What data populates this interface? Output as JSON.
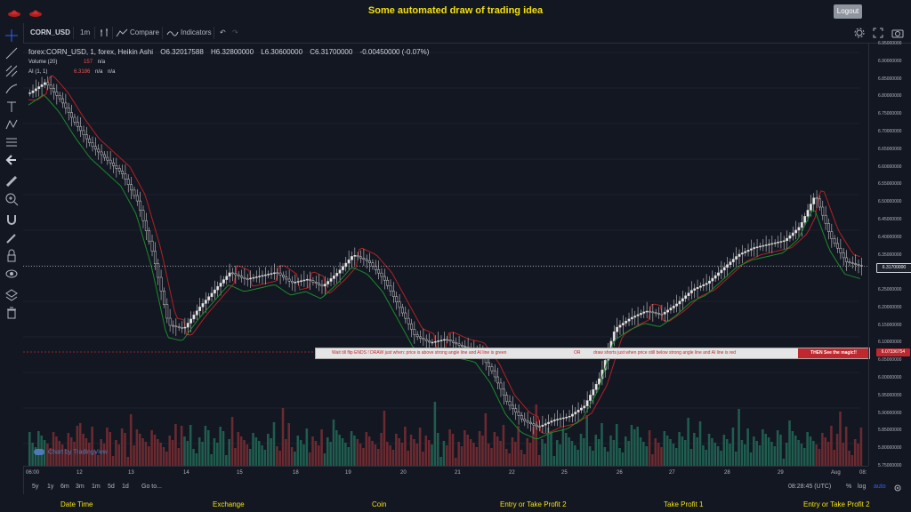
{
  "app": {
    "title": "Some automated draw of trading idea",
    "logout_label": "Logout"
  },
  "toolbar": {
    "symbol": "CORN_USD",
    "interval": "1m",
    "compare_label": "Compare",
    "indicators_label": "Indicators"
  },
  "legend": {
    "symbol_line": "forex:CORN_USD, 1, forex, Heikin Ashi",
    "open": "O6.32017588",
    "high": "H6.32800000",
    "low": "L6.30600000",
    "close": "C6.31700000",
    "change": "-0.00450000 (-0.07%)",
    "volume_label": "Volume (20)",
    "volume_value": "157",
    "volume_na": "n/a",
    "ai_label": "AI (1, 1)",
    "ai_value": "6.3186",
    "ai_na1": "n/a",
    "ai_na2": "n/a"
  },
  "price_axis": {
    "ticks": [
      "6.95000000",
      "6.90000000",
      "6.85000000",
      "6.80000000",
      "6.75000000",
      "6.70000000",
      "6.65000000",
      "6.60000000",
      "6.55000000",
      "6.50000000",
      "6.45000000",
      "6.40000000",
      "6.35000000",
      "6.30000000",
      "6.25000000",
      "6.20000000",
      "6.15000000",
      "6.10000000",
      "6.05000000",
      "6.00000000",
      "5.95000000",
      "5.90000000",
      "5.85000000",
      "5.80000000",
      "5.75000000"
    ],
    "current_price": "6.31700000",
    "marker_price": "6.07336754"
  },
  "time_axis": [
    "06:00",
    "12",
    "13",
    "14",
    "15",
    "18",
    "19",
    "20",
    "21",
    "22",
    "25",
    "26",
    "27",
    "28",
    "29",
    "Aug",
    "08:"
  ],
  "bottom_bar": {
    "ranges": [
      "5y",
      "1y",
      "6m",
      "3m",
      "1m",
      "5d",
      "1d"
    ],
    "goto": "Go to...",
    "clock": "08:28:45 (UTC)",
    "percent": "%",
    "log": "log",
    "auto": "auto"
  },
  "banner": {
    "part1": "Wait till flip ENDS  !   DRAW just when:  price is above strong angle line and AI line is green",
    "part2": "OR",
    "part3": "draw shorts just when price still below strong angle line and AI line is red",
    "part4": "THEN See the magic!!"
  },
  "watermark": "Chart by TradingView",
  "footer": [
    "Date Time",
    "Exchange",
    "Coin",
    "Entry or Take Profit 2",
    "Take Profit 1",
    "Entry or Take Profit 2"
  ],
  "colors": {
    "accent": "#f4e10a",
    "up": "#26a69a",
    "down": "#ef5350",
    "background": "#131722"
  },
  "chart_data": {
    "type": "line",
    "title": "",
    "series": [
      {
        "values": [
          6.81,
          6.84,
          6.79,
          6.72,
          6.66,
          6.62,
          6.58,
          6.5,
          6.35,
          6.15,
          6.14,
          6.2,
          6.25,
          6.3,
          6.28,
          6.29,
          6.3,
          6.27,
          6.28,
          6.26,
          6.3,
          6.35,
          6.33,
          6.28,
          6.2,
          6.12,
          6.1,
          6.11,
          6.09,
          6.08,
          6.02,
          5.93,
          5.88,
          5.86,
          5.88,
          5.89,
          5.92,
          6.0,
          6.14,
          6.17,
          6.19,
          6.18,
          6.21,
          6.25,
          6.27,
          6.31,
          6.35,
          6.37,
          6.38,
          6.39,
          6.43,
          6.52,
          6.4,
          6.33,
          6.317
        ]
      }
    ],
    "x": [
      "06:00",
      "12",
      "13",
      "14",
      "15",
      "18",
      "19",
      "20",
      "21",
      "22",
      "25",
      "26",
      "27",
      "28",
      "29",
      "Aug"
    ],
    "ylim": [
      5.75,
      6.95
    ]
  }
}
